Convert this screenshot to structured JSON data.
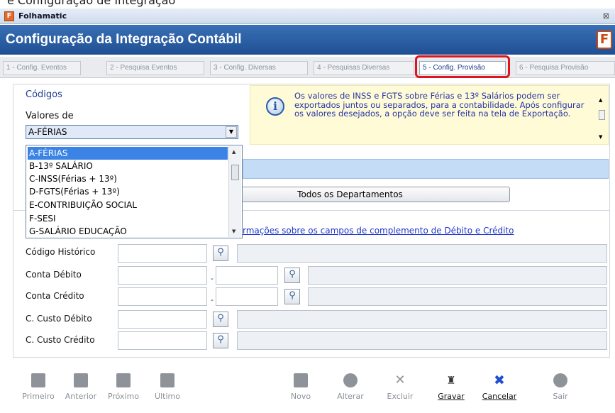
{
  "window": {
    "top_strip_text": "e Configuração de Integração",
    "title": "Folhamatic",
    "close_glyph": "⊠"
  },
  "header": {
    "title": "Configuração da Integração Contábil",
    "logo_glyph": "F"
  },
  "tabs": [
    {
      "label": "1 - Config. Eventos"
    },
    {
      "label": "2 - Pesquisa Eventos"
    },
    {
      "label": "3 - Config. Diversas"
    },
    {
      "label": "4 - Pesquisas Diversas"
    },
    {
      "label": "5 - Config. Provisão"
    },
    {
      "label": "6 - Pesquisa Provisão"
    }
  ],
  "codigos": {
    "section": "Códigos",
    "valores_label": "Valores de",
    "selected": "A-FÉRIAS"
  },
  "dropdown": {
    "options": [
      "A-FÉRIAS",
      "B-13º SALÁRIO",
      "C-INSS(Férias + 13º)",
      "D-FGTS(Férias + 13º)",
      "E-CONTRIBUIÇÃO SOCIAL",
      "F-SESI",
      "G-SALÁRIO EDUCAÇÃO"
    ]
  },
  "info": {
    "text": "Os valores de INSS e FGTS sobre Férias e 13º Salários podem ser exportados juntos ou separados, para a contabilidade. Após configurar os valores desejados, a opção deve ser feita na tela de Exportação."
  },
  "departments_button": "Todos os Departamentos",
  "link_text": "rmações sobre os campos de complemento de Débito e Crédito",
  "fields": {
    "codigo_historico": "Código Histórico",
    "conta_debito": "Conta Débito",
    "conta_credito": "Conta Crédito",
    "c_custo_debito": "C. Custo Débito",
    "c_custo_credito": "C. Custo Crédito"
  },
  "toolbar": {
    "primeiro": "Primeiro",
    "anterior": "Anterior",
    "proximo": "Próximo",
    "ultimo": "Último",
    "novo": "Novo",
    "alterar": "Alterar",
    "excluir": "Excluir",
    "gravar": "Gravar",
    "cancelar": "Cancelar",
    "sair": "Sair"
  },
  "colors": {
    "header": "#2a5ca8",
    "highlight": "#e0141d",
    "info_bg": "#fffbd6",
    "link": "#1f37c9"
  }
}
